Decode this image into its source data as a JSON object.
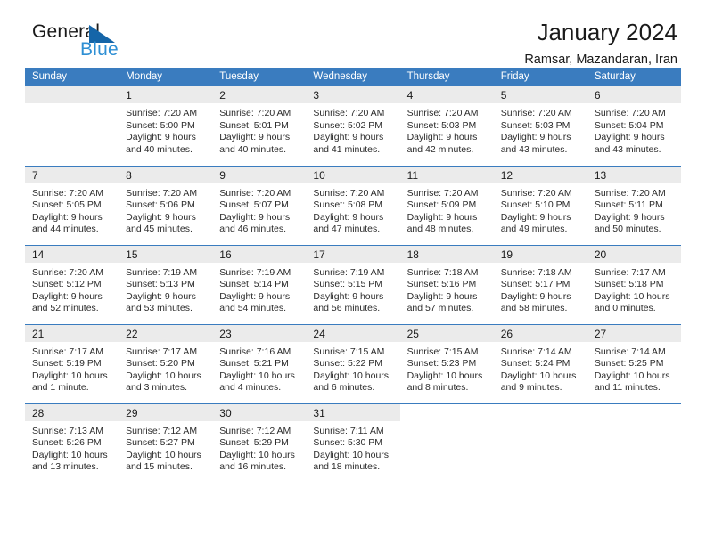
{
  "brand": {
    "name_part1": "General",
    "name_part2": "Blue",
    "flag_icon": "blue-triangle-flag-icon",
    "accent_color": "#2e8fd4"
  },
  "header": {
    "title": "January 2024",
    "subtitle": "Ramsar, Mazandaran, Iran"
  },
  "theme": {
    "header_band": "#3a7cbf",
    "daynum_band": "#ebebeb",
    "text": "#1a1a1a"
  },
  "calendar": {
    "weekday_headers": [
      "Sunday",
      "Monday",
      "Tuesday",
      "Wednesday",
      "Thursday",
      "Friday",
      "Saturday"
    ],
    "weeks": [
      [
        {
          "day": "",
          "lines": []
        },
        {
          "day": "1",
          "lines": [
            "Sunrise: 7:20 AM",
            "Sunset: 5:00 PM",
            "Daylight: 9 hours",
            "and 40 minutes."
          ]
        },
        {
          "day": "2",
          "lines": [
            "Sunrise: 7:20 AM",
            "Sunset: 5:01 PM",
            "Daylight: 9 hours",
            "and 40 minutes."
          ]
        },
        {
          "day": "3",
          "lines": [
            "Sunrise: 7:20 AM",
            "Sunset: 5:02 PM",
            "Daylight: 9 hours",
            "and 41 minutes."
          ]
        },
        {
          "day": "4",
          "lines": [
            "Sunrise: 7:20 AM",
            "Sunset: 5:03 PM",
            "Daylight: 9 hours",
            "and 42 minutes."
          ]
        },
        {
          "day": "5",
          "lines": [
            "Sunrise: 7:20 AM",
            "Sunset: 5:03 PM",
            "Daylight: 9 hours",
            "and 43 minutes."
          ]
        },
        {
          "day": "6",
          "lines": [
            "Sunrise: 7:20 AM",
            "Sunset: 5:04 PM",
            "Daylight: 9 hours",
            "and 43 minutes."
          ]
        }
      ],
      [
        {
          "day": "7",
          "lines": [
            "Sunrise: 7:20 AM",
            "Sunset: 5:05 PM",
            "Daylight: 9 hours",
            "and 44 minutes."
          ]
        },
        {
          "day": "8",
          "lines": [
            "Sunrise: 7:20 AM",
            "Sunset: 5:06 PM",
            "Daylight: 9 hours",
            "and 45 minutes."
          ]
        },
        {
          "day": "9",
          "lines": [
            "Sunrise: 7:20 AM",
            "Sunset: 5:07 PM",
            "Daylight: 9 hours",
            "and 46 minutes."
          ]
        },
        {
          "day": "10",
          "lines": [
            "Sunrise: 7:20 AM",
            "Sunset: 5:08 PM",
            "Daylight: 9 hours",
            "and 47 minutes."
          ]
        },
        {
          "day": "11",
          "lines": [
            "Sunrise: 7:20 AM",
            "Sunset: 5:09 PM",
            "Daylight: 9 hours",
            "and 48 minutes."
          ]
        },
        {
          "day": "12",
          "lines": [
            "Sunrise: 7:20 AM",
            "Sunset: 5:10 PM",
            "Daylight: 9 hours",
            "and 49 minutes."
          ]
        },
        {
          "day": "13",
          "lines": [
            "Sunrise: 7:20 AM",
            "Sunset: 5:11 PM",
            "Daylight: 9 hours",
            "and 50 minutes."
          ]
        }
      ],
      [
        {
          "day": "14",
          "lines": [
            "Sunrise: 7:20 AM",
            "Sunset: 5:12 PM",
            "Daylight: 9 hours",
            "and 52 minutes."
          ]
        },
        {
          "day": "15",
          "lines": [
            "Sunrise: 7:19 AM",
            "Sunset: 5:13 PM",
            "Daylight: 9 hours",
            "and 53 minutes."
          ]
        },
        {
          "day": "16",
          "lines": [
            "Sunrise: 7:19 AM",
            "Sunset: 5:14 PM",
            "Daylight: 9 hours",
            "and 54 minutes."
          ]
        },
        {
          "day": "17",
          "lines": [
            "Sunrise: 7:19 AM",
            "Sunset: 5:15 PM",
            "Daylight: 9 hours",
            "and 56 minutes."
          ]
        },
        {
          "day": "18",
          "lines": [
            "Sunrise: 7:18 AM",
            "Sunset: 5:16 PM",
            "Daylight: 9 hours",
            "and 57 minutes."
          ]
        },
        {
          "day": "19",
          "lines": [
            "Sunrise: 7:18 AM",
            "Sunset: 5:17 PM",
            "Daylight: 9 hours",
            "and 58 minutes."
          ]
        },
        {
          "day": "20",
          "lines": [
            "Sunrise: 7:17 AM",
            "Sunset: 5:18 PM",
            "Daylight: 10 hours",
            "and 0 minutes."
          ]
        }
      ],
      [
        {
          "day": "21",
          "lines": [
            "Sunrise: 7:17 AM",
            "Sunset: 5:19 PM",
            "Daylight: 10 hours",
            "and 1 minute."
          ]
        },
        {
          "day": "22",
          "lines": [
            "Sunrise: 7:17 AM",
            "Sunset: 5:20 PM",
            "Daylight: 10 hours",
            "and 3 minutes."
          ]
        },
        {
          "day": "23",
          "lines": [
            "Sunrise: 7:16 AM",
            "Sunset: 5:21 PM",
            "Daylight: 10 hours",
            "and 4 minutes."
          ]
        },
        {
          "day": "24",
          "lines": [
            "Sunrise: 7:15 AM",
            "Sunset: 5:22 PM",
            "Daylight: 10 hours",
            "and 6 minutes."
          ]
        },
        {
          "day": "25",
          "lines": [
            "Sunrise: 7:15 AM",
            "Sunset: 5:23 PM",
            "Daylight: 10 hours",
            "and 8 minutes."
          ]
        },
        {
          "day": "26",
          "lines": [
            "Sunrise: 7:14 AM",
            "Sunset: 5:24 PM",
            "Daylight: 10 hours",
            "and 9 minutes."
          ]
        },
        {
          "day": "27",
          "lines": [
            "Sunrise: 7:14 AM",
            "Sunset: 5:25 PM",
            "Daylight: 10 hours",
            "and 11 minutes."
          ]
        }
      ],
      [
        {
          "day": "28",
          "lines": [
            "Sunrise: 7:13 AM",
            "Sunset: 5:26 PM",
            "Daylight: 10 hours",
            "and 13 minutes."
          ]
        },
        {
          "day": "29",
          "lines": [
            "Sunrise: 7:12 AM",
            "Sunset: 5:27 PM",
            "Daylight: 10 hours",
            "and 15 minutes."
          ]
        },
        {
          "day": "30",
          "lines": [
            "Sunrise: 7:12 AM",
            "Sunset: 5:29 PM",
            "Daylight: 10 hours",
            "and 16 minutes."
          ]
        },
        {
          "day": "31",
          "lines": [
            "Sunrise: 7:11 AM",
            "Sunset: 5:30 PM",
            "Daylight: 10 hours",
            "and 18 minutes."
          ]
        },
        {
          "day": "",
          "lines": []
        },
        {
          "day": "",
          "lines": []
        },
        {
          "day": "",
          "lines": []
        }
      ]
    ]
  }
}
